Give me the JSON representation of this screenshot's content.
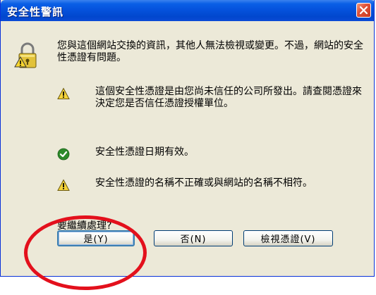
{
  "dialog": {
    "title": "安全性警訊",
    "close_icon": "close-icon",
    "lock_icon": "padlock-warning-icon",
    "message": "您與這個網站交換的資訊，其他人無法檢視或變更。不過，網站的安全性憑證有問題。",
    "items": [
      {
        "icon": "warning-icon",
        "text": "這個安全性憑證是由您尚未信任的公司所發出。請查閱憑證來決定您是否信任憑證授權單位。"
      },
      {
        "icon": "check-icon",
        "text": "安全性憑證日期有效。"
      },
      {
        "icon": "warning-icon",
        "text": "安全性憑證的名稱不正確或與網站的名稱不相符。"
      }
    ],
    "prompt": "要繼續處理?",
    "buttons": {
      "yes": "是(Y)",
      "no": "否(N)",
      "view_cert": "檢視憑證(V)"
    }
  },
  "colors": {
    "titlebar": "#0552dd",
    "dialog_bg": "#ece9d8",
    "close_button": "#e0533a",
    "highlight_ring": "#e3101c",
    "warning": "#f5d33a",
    "check": "#2d8a2a"
  }
}
